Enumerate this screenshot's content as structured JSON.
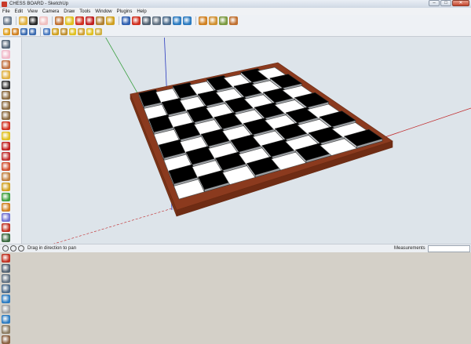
{
  "window": {
    "title": "CHESS BOARD - SketchUp",
    "min_label": "–",
    "max_label": "□",
    "close_label": "✕"
  },
  "menu": [
    "File",
    "Edit",
    "View",
    "Camera",
    "Draw",
    "Tools",
    "Window",
    "Plugins",
    "Help"
  ],
  "toolbar_row1": [
    {
      "name": "select-icon",
      "color": "#6a7a8c"
    },
    {
      "name": "pencil-icon",
      "color": "#e0b040"
    },
    {
      "name": "rectangle-icon",
      "color": "#2a2a2a"
    },
    {
      "name": "eraser-icon",
      "color": "#f0c0c0"
    },
    {
      "name": "paint-bucket-icon",
      "color": "#c07030"
    },
    {
      "name": "push-pull-icon",
      "color": "#e0c020"
    },
    {
      "name": "move-icon",
      "color": "#d03020"
    },
    {
      "name": "rotate-icon",
      "color": "#c02020"
    },
    {
      "name": "offset-icon",
      "color": "#b08030"
    },
    {
      "name": "tape-measure-icon",
      "color": "#d0a020"
    },
    {
      "name": "orbit-icon",
      "color": "#3060b0"
    },
    {
      "name": "pan-icon",
      "color": "#d03020"
    },
    {
      "name": "zoom-icon",
      "color": "#506070"
    },
    {
      "name": "zoom-window-icon",
      "color": "#607080"
    },
    {
      "name": "zoom-extents-icon",
      "color": "#4a6a8a"
    },
    {
      "name": "previous-view-icon",
      "color": "#2a7ac0"
    },
    {
      "name": "next-view-icon",
      "color": "#2a7ac0"
    },
    {
      "name": "get-models-icon",
      "color": "#d08020"
    },
    {
      "name": "share-model-icon",
      "color": "#d09030"
    },
    {
      "name": "components-icon",
      "color": "#7a9a40"
    },
    {
      "name": "extension-icon",
      "color": "#c07030"
    }
  ],
  "toolbar_row2": [
    {
      "name": "section-plane-icon",
      "color": "#e0a020"
    },
    {
      "name": "display-section-icon",
      "color": "#d08020"
    },
    {
      "name": "xray-icon",
      "color": "#3a6ab0"
    },
    {
      "name": "back-edges-icon",
      "color": "#3a6ab0"
    },
    {
      "name": "wireframe-icon",
      "color": "#4a7ac0"
    },
    {
      "name": "hidden-line-icon",
      "color": "#d0a020"
    },
    {
      "name": "shaded-icon",
      "color": "#c09030"
    },
    {
      "name": "textured-icon",
      "color": "#e0c020"
    },
    {
      "name": "monochrome-icon",
      "color": "#d0a030"
    },
    {
      "name": "shadows-icon",
      "color": "#e0c020"
    },
    {
      "name": "fog-icon",
      "color": "#d0b040"
    }
  ],
  "left_tools": [
    "select-icon",
    "eraser-icon",
    "paint-bucket-icon",
    "pencil-icon",
    "rectangle-icon",
    "arc-icon",
    "circle-icon",
    "polygon-icon",
    "move-icon",
    "push-pull-icon",
    "rotate-icon",
    "follow-me-icon",
    "scale-icon",
    "offset-icon",
    "tape-measure-icon",
    "dimension-icon",
    "protractor-icon",
    "text-icon",
    "axes-icon",
    "3d-text-icon",
    "orbit-icon",
    "pan-icon",
    "zoom-icon",
    "zoom-window-icon",
    "zoom-extents-icon",
    "previous-icon",
    "position-camera-icon",
    "look-around-icon",
    "walk-icon",
    "section-icon"
  ],
  "left_tool_colors": [
    "#556677",
    "#f0b8c8",
    "#c07040",
    "#e0b040",
    "#333333",
    "#8a6a40",
    "#8a6a40",
    "#8a6a40",
    "#d03020",
    "#e0c020",
    "#c02020",
    "#c03030",
    "#d05030",
    "#c08040",
    "#d0a020",
    "#40a040",
    "#d08020",
    "#7070d0",
    "#c03020",
    "#3a6a40",
    "#3060b0",
    "#c03020",
    "#506070",
    "#607080",
    "#4a6a8a",
    "#2a7ac0",
    "#a0a0a0",
    "#2a7ac0",
    "#8a7a60",
    "#8a6040"
  ],
  "status": {
    "message": "Drag in direction to pan",
    "measurements_label": "Measurements",
    "measurements_value": ""
  },
  "scene": {
    "board_frame_color": "#8b3a1e",
    "board_frame_edge": "#6a2a12",
    "dark_square": "#000000",
    "light_square": "#ffffff",
    "squares_per_side": 8,
    "axis_red": "#c0282a",
    "axis_green": "#3aa040",
    "axis_blue": "#2a3ac0",
    "sky": "#dde4ea",
    "ground": "#e6eaee"
  }
}
